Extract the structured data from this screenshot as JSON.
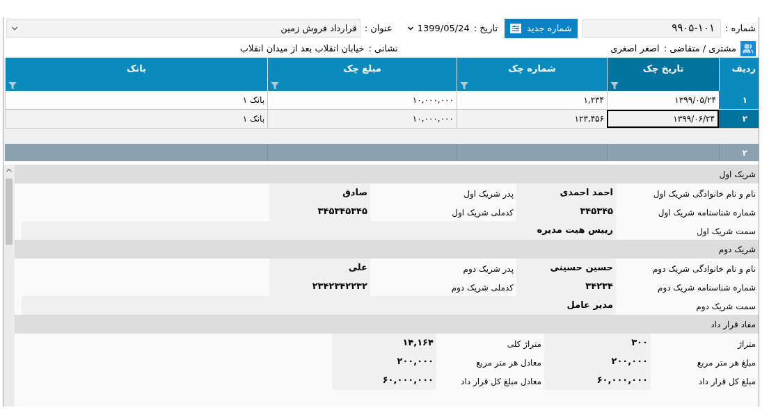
{
  "header": {
    "number_label": "شماره :",
    "number_value": "۹۹۰۵-۱۰۱",
    "new_number_button": "شماره جدید",
    "date_label": "تاریخ :",
    "date_value": "1399/05/24",
    "title_label": "عنوان :",
    "title_value": "قرارداد فروش زمین"
  },
  "customer": {
    "label": "مشتری / متقاضی :",
    "value": "اصغر اصغری"
  },
  "address": {
    "label": "نشانی :",
    "value": "خیابان انقلاب بعد از میدان انقلاب"
  },
  "table": {
    "columns": [
      {
        "label": "ردیف",
        "selected": false,
        "filter": false
      },
      {
        "label": "تاریخ چک",
        "selected": true,
        "filter": true
      },
      {
        "label": "شماره چک",
        "selected": false,
        "filter": true
      },
      {
        "label": "مبلغ چک",
        "selected": false,
        "filter": true
      },
      {
        "label": "بانک",
        "selected": false,
        "filter": true
      }
    ],
    "rows": [
      {
        "selected": false,
        "cells": [
          "۱",
          "۱۳۹۹/۰۵/۲۴",
          "۱,۲۳۴",
          "۱۰,۰۰۰,۰۰۰",
          "بانک ۱"
        ]
      },
      {
        "selected": true,
        "cells": [
          "۲",
          "۱۳۹۹/۰۶/۲۴",
          "۱۲۳,۴۵۶",
          "۱۰,۰۰۰,۰۰۰",
          "بانک ۱"
        ]
      }
    ],
    "summary": {
      "count": "۲"
    }
  },
  "sections": [
    {
      "title": "شریک اول",
      "kind": "partner",
      "rows": [
        [
          {
            "label": "نام و نام خانوادگی شریک اول",
            "value": "احمد احمدی"
          },
          {
            "label": "پدر شریک اول",
            "value": "صادق"
          }
        ],
        [
          {
            "label": "شماره شناسنامه شریک اول",
            "value": "۳۴۵۳۴۵"
          },
          {
            "label": "کدملی شریک اول",
            "value": "۳۴۵۳۴۵۳۴۵"
          }
        ],
        [
          {
            "label": "سمت شریک اول",
            "value": "رییس هیت مدیره"
          }
        ]
      ]
    },
    {
      "title": "شریک دوم",
      "kind": "partner",
      "rows": [
        [
          {
            "label": "نام و نام خانوادگی شریک دوم",
            "value": "حسین حسینی"
          },
          {
            "label": "پدر شریک دوم",
            "value": "علی"
          }
        ],
        [
          {
            "label": "شماره شناسنامه شریک دوم",
            "value": "۳۴۲۳۴"
          },
          {
            "label": "کدملی شریک دوم",
            "value": "۲۳۴۲۳۴۲۲۳۲"
          }
        ],
        [
          {
            "label": "سمت شریک دوم",
            "value": "مدیر عامل"
          }
        ]
      ]
    },
    {
      "title": "مفاد قرار داد",
      "kind": "contract",
      "rows": [
        [
          {
            "label": "متراژ",
            "value": "۳۰۰"
          },
          {
            "label": "متراژ کلی",
            "value": "۱۴,۱۶۴"
          }
        ],
        [
          {
            "label": "مبلغ هر متر مربع",
            "value": "۲۰۰,۰۰۰"
          },
          {
            "label": "معادل هر متر مربع",
            "value": "۲۰۰,۰۰۰"
          }
        ],
        [
          {
            "label": "مبلغ کل قرار داد",
            "value": "۶۰,۰۰۰,۰۰۰"
          },
          {
            "label": "معادل مبلغ کل قرار داد",
            "value": "۶۰,۰۰۰,۰۰۰"
          }
        ]
      ]
    }
  ]
}
